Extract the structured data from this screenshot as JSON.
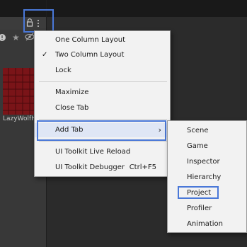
{
  "menu": {
    "items": [
      {
        "label": "One Column Layout",
        "checked": false
      },
      {
        "label": "Two Column Layout",
        "checked": true
      },
      {
        "label": "Lock",
        "checked": false
      },
      {
        "label": "Maximize",
        "checked": false
      },
      {
        "label": "Close Tab",
        "checked": false
      },
      {
        "label": "Add Tab",
        "checked": false,
        "submenu": true
      },
      {
        "label": "UI Toolkit Live Reload",
        "checked": false
      },
      {
        "label": "UI Toolkit Debugger",
        "shortcut": "Ctrl+F5",
        "checked": false
      }
    ],
    "check_glyph": "✓",
    "submenu_arrow": "›"
  },
  "submenu": {
    "items": [
      "Scene",
      "Game",
      "Inspector",
      "Hierarchy",
      "Project",
      "Profiler",
      "Animation"
    ],
    "selected": "Project"
  },
  "panel": {
    "asset_label": "LazyWolfH..."
  },
  "colors": {
    "highlight": "#4a78d8",
    "menu_bg": "#f2f2f2",
    "editor_bg": "#282828",
    "asset_thumb": "#7a1418"
  }
}
